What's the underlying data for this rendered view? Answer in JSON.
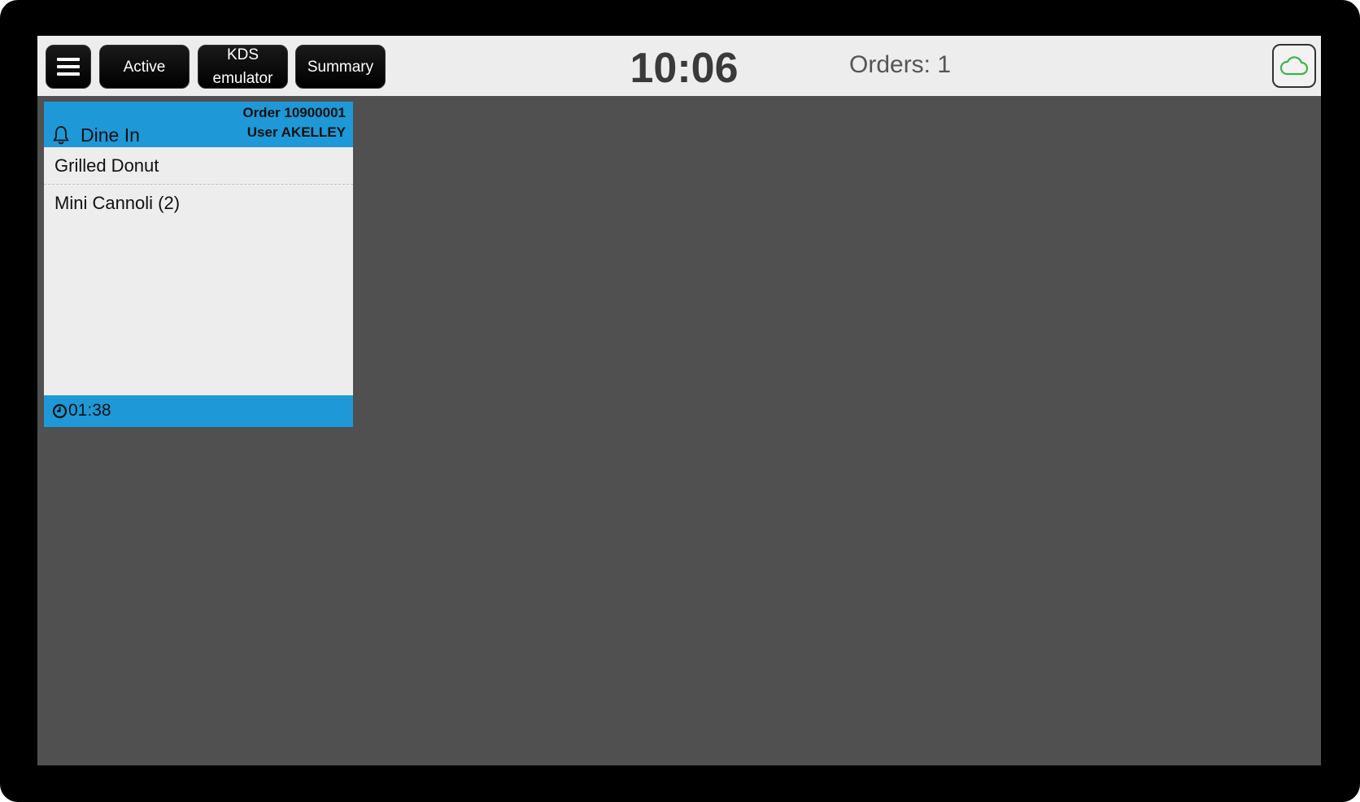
{
  "toolbar": {
    "menu_icon": "hamburger-menu-icon",
    "active_label": "Active",
    "kds_label_line1": "KDS",
    "kds_label_line2": "emulator",
    "summary_label": "Summary",
    "clock": "10:06",
    "orders_count": "Orders: 1",
    "cloud_icon": "cloud-icon",
    "cloud_color": "#3cb44a"
  },
  "order_card": {
    "order_number": "Order 10900001",
    "user": "User AKELLEY",
    "order_type": "Dine In",
    "bell_icon": "bell-icon",
    "items": [
      {
        "label": "Grilled Donut"
      },
      {
        "label": "Mini Cannoli (2)"
      }
    ],
    "timer_icon": "clock-icon",
    "elapsed": "01:38",
    "header_color": "#1e98d6"
  }
}
